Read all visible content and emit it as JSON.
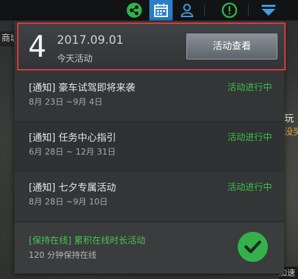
{
  "topbar": {
    "icons": [
      "share-icon",
      "calendar-icon",
      "user-icon",
      "alert-icon",
      "dropdown-icon"
    ],
    "accent": "#2a7fc7"
  },
  "background": {
    "left_text": "商城",
    "right_text_1": "玩",
    "right_text_2": "没奖",
    "right_text_3": "加速"
  },
  "header": {
    "day": "4",
    "date": "2017.09.01",
    "today_label": "今天活动",
    "view_button": "活动查看",
    "highlight_color": "#e03a3a"
  },
  "activities": [
    {
      "title": "[通知] 豪车试驾即将来袭",
      "dates": "8月 23日 ~9月 4日",
      "status": "活动进行中"
    },
    {
      "title": "[通知] 任务中心指引",
      "dates": "6月 28日 ~ 12月 31日",
      "status": "活动进行中"
    },
    {
      "title": "[通知] 七夕专属活动",
      "dates": "8月 28日 ~9月 10日",
      "status": "活动进行中"
    }
  ],
  "online_activity": {
    "title": "[保持在线] 累积在线时长活动",
    "subtitle": "120 分钟保持在线",
    "status_icon": "checkmark-icon",
    "color": "#34b14a"
  }
}
